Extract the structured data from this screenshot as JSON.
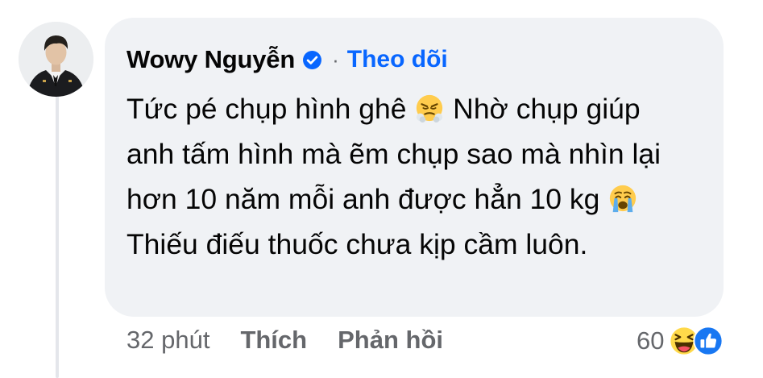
{
  "comment": {
    "author": "Wowy Nguyễn",
    "verified": true,
    "separator": "·",
    "follow_label": "Theo dõi",
    "text_parts": [
      "Tức pé chụp hình ghê ",
      " Nhờ chụp giúp anh tấm hình mà ẽm chụp sao mà nhìn lại hơn 10 năm mỗi anh được hẳn 10 kg ",
      " Thiếu điếu thuốc chưa kịp cầm luôn."
    ],
    "emojis": [
      "steam-from-nose-emoji",
      "loudly-crying-emoji"
    ]
  },
  "actions": {
    "time": "32 phút",
    "like_label": "Thích",
    "reply_label": "Phản hồi"
  },
  "reactions": {
    "count": "60",
    "icons": [
      "haha-reaction-icon",
      "like-reaction-icon"
    ]
  },
  "colors": {
    "bubble": "#f0f2f5",
    "link_blue": "#0866ff",
    "secondary_text": "#65676b",
    "thread_line": "#e4e6eb"
  }
}
